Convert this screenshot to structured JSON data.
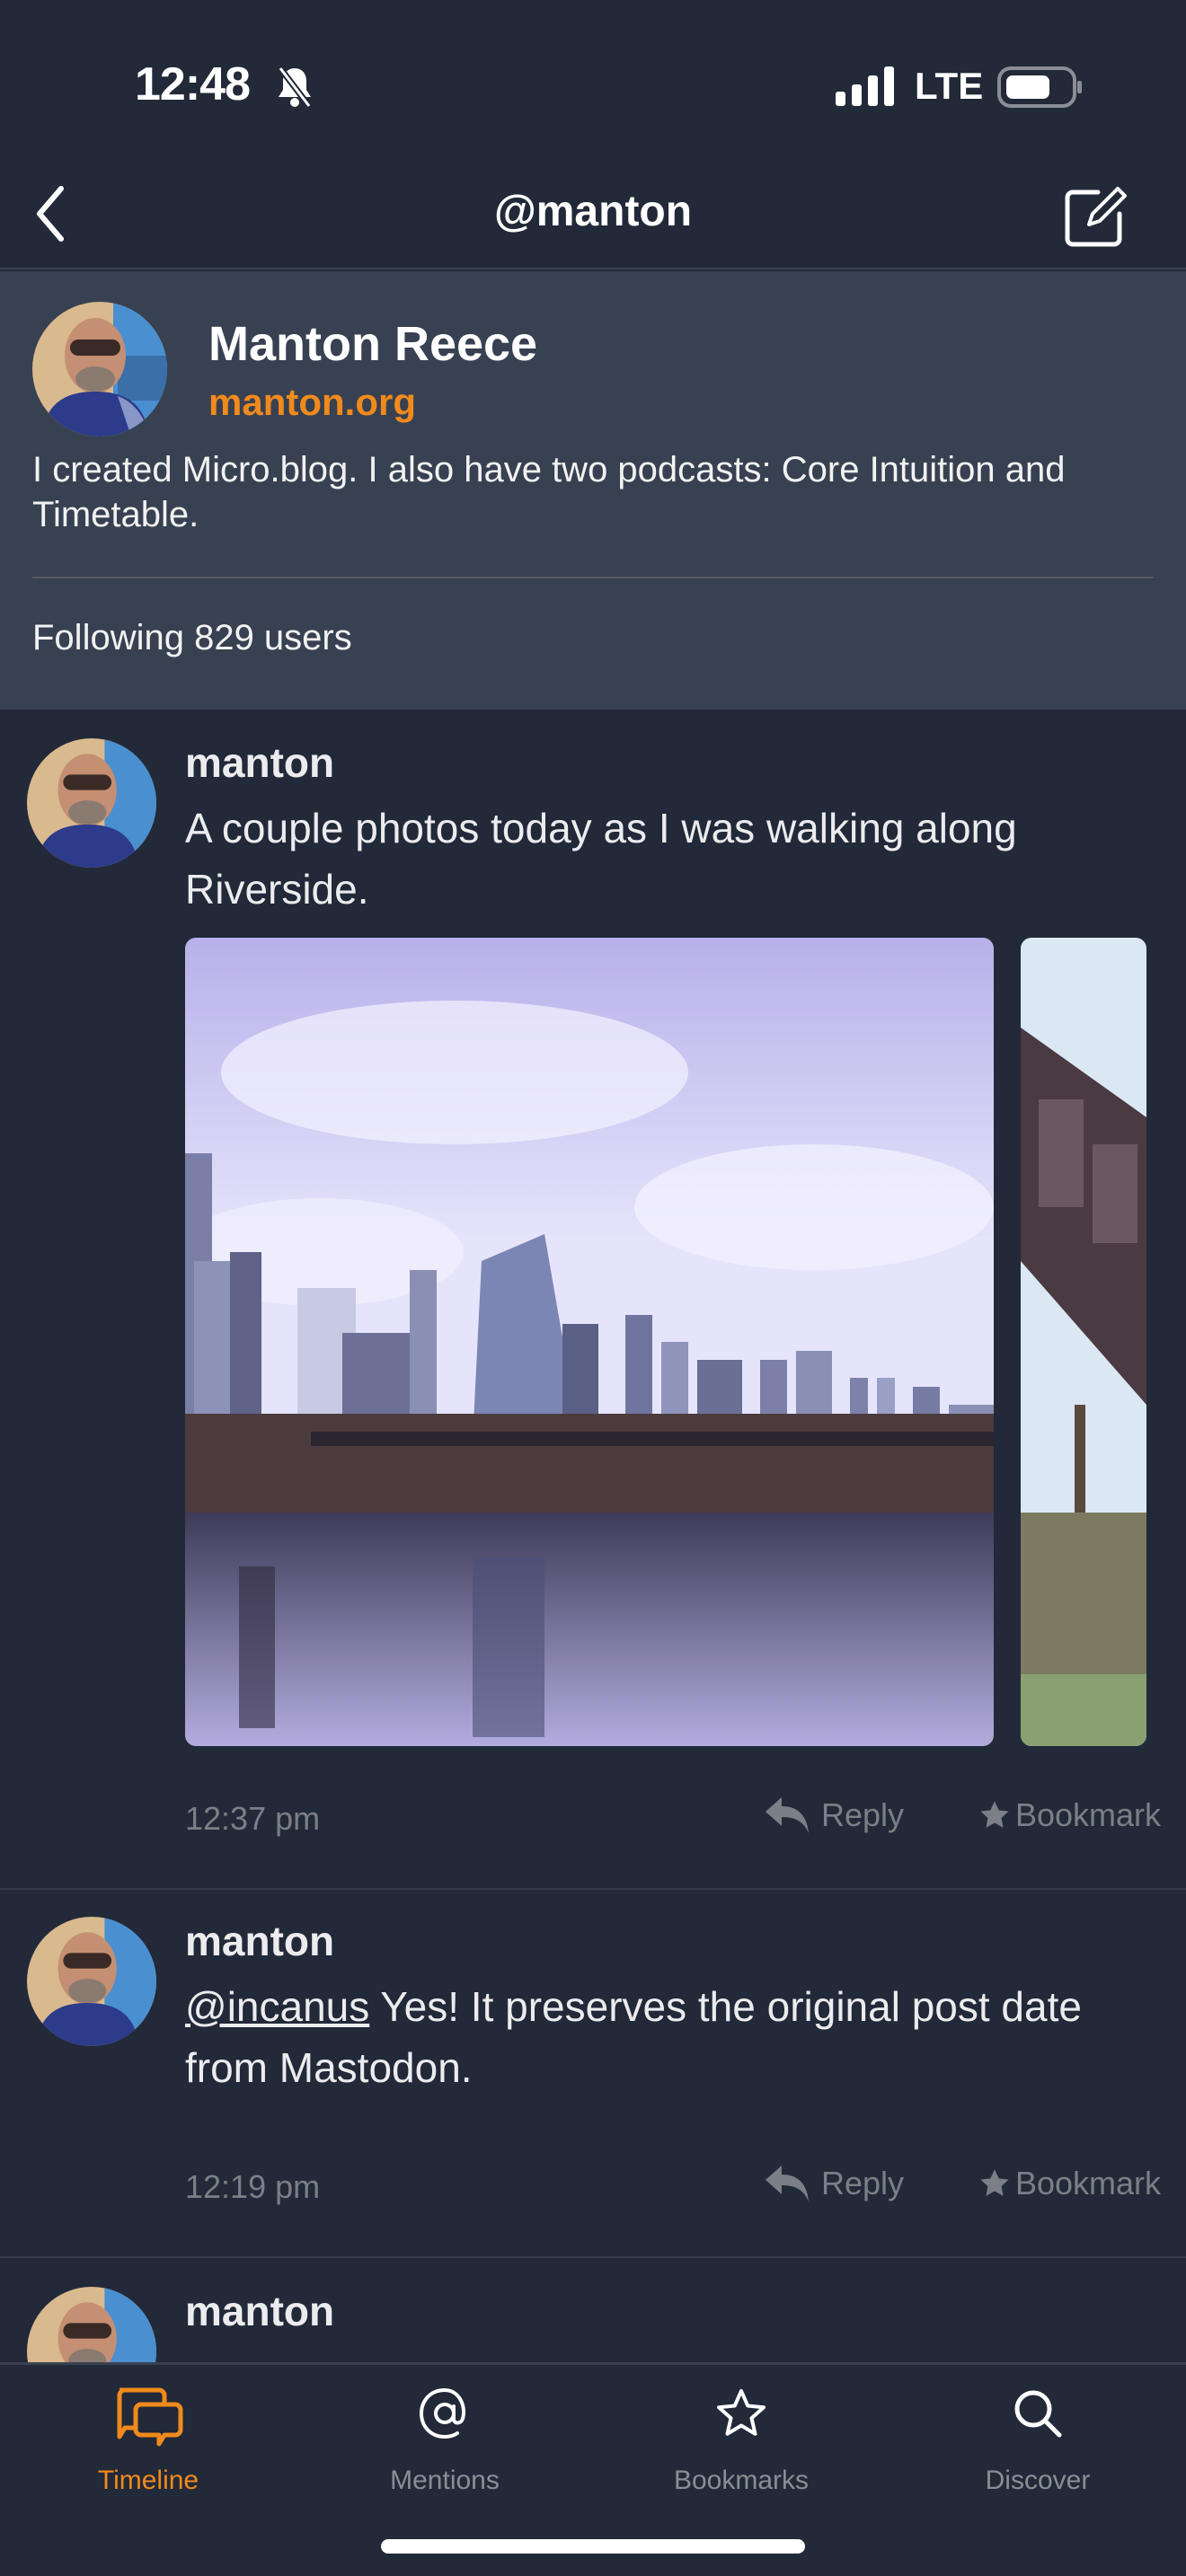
{
  "status_bar": {
    "time": "12:48",
    "network": "LTE",
    "icons": [
      "bell-slash-icon",
      "signal-icon",
      "battery-icon"
    ]
  },
  "nav": {
    "title": "@manton",
    "left_icon": "chevron-left-icon",
    "right_icon": "compose-icon"
  },
  "profile": {
    "name": "Manton Reece",
    "url": "manton.org",
    "bio": "I created Micro.blog. I also have two podcasts: Core Intuition and Timetable.",
    "following": "Following 829 users"
  },
  "posts": [
    {
      "author": "manton",
      "text": "A couple photos today as I was walking along Riverside.",
      "photos": [
        "Austin skyline over the river with a rail bridge",
        "Underside of a steel bridge with trees"
      ],
      "time": "12:37 pm",
      "reply_label": "Reply",
      "bookmark_label": "Bookmark"
    },
    {
      "author": "manton",
      "mention": "@incanus",
      "text": " Yes! It preserves the original post date from Mastodon.",
      "time": "12:19 pm",
      "reply_label": "Reply",
      "bookmark_label": "Bookmark"
    },
    {
      "author": "manton"
    }
  ],
  "tabs": [
    {
      "label": "Timeline",
      "icon": "chat-bubbles-icon",
      "active": true
    },
    {
      "label": "Mentions",
      "icon": "at-icon",
      "active": false
    },
    {
      "label": "Bookmarks",
      "icon": "star-icon",
      "active": false
    },
    {
      "label": "Discover",
      "icon": "search-icon",
      "active": false
    }
  ],
  "colors": {
    "background": "#222938",
    "profile_background": "#384152",
    "accent": "#f08a1c",
    "muted_text": "#7b7f86"
  }
}
